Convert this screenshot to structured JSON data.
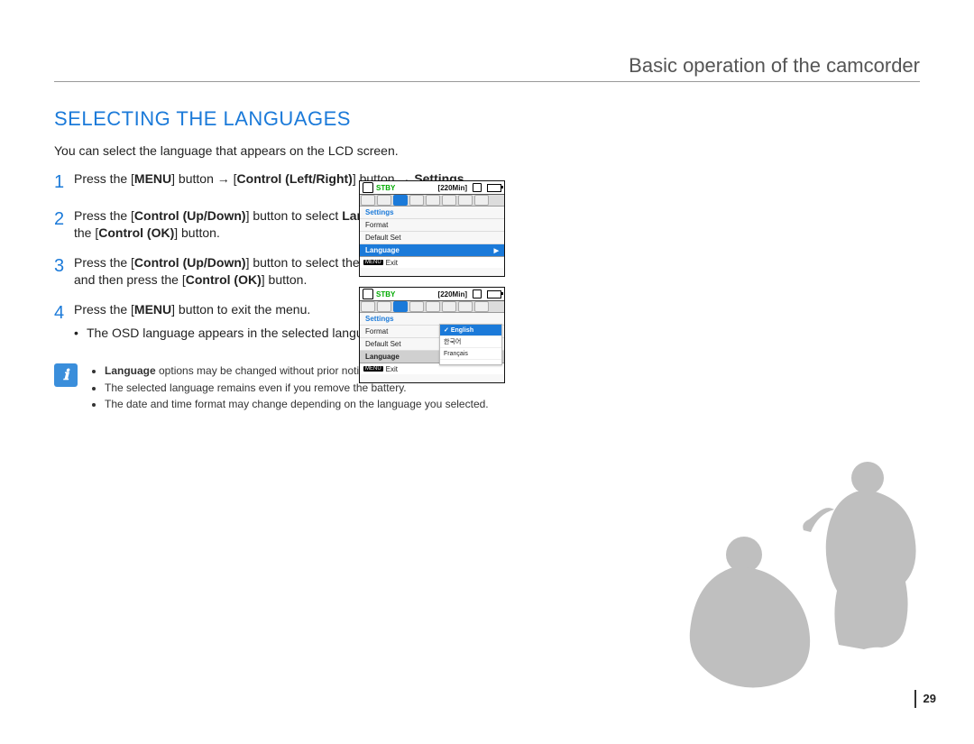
{
  "header": {
    "section": "Basic operation of the camcorder"
  },
  "title": "SELECTING THE LANGUAGES",
  "intro": "You can select the language that appears on the LCD screen.",
  "steps": [
    {
      "num": "1",
      "parts": [
        {
          "t": "Press the ["
        },
        {
          "t": "MENU",
          "b": true
        },
        {
          "t": "] button → ["
        },
        {
          "t": "Control (Left/Right)",
          "b": true
        },
        {
          "t": "] button → "
        },
        {
          "t": "Settings",
          "b": true
        },
        {
          "t": "."
        }
      ]
    },
    {
      "num": "2",
      "parts": [
        {
          "t": "Press the ["
        },
        {
          "t": "Control (Up/Down)",
          "b": true
        },
        {
          "t": "] button to select "
        },
        {
          "t": "Language",
          "b": true
        },
        {
          "t": ", and then press the ["
        },
        {
          "t": "Control (OK)",
          "b": true
        },
        {
          "t": "] button."
        }
      ]
    },
    {
      "num": "3",
      "parts": [
        {
          "t": "Press the ["
        },
        {
          "t": "Control (Up/Down)",
          "b": true
        },
        {
          "t": "] button to select the desired OSD language, and then press the ["
        },
        {
          "t": "Control (OK)",
          "b": true
        },
        {
          "t": "] button."
        }
      ]
    },
    {
      "num": "4",
      "parts": [
        {
          "t": "Press the ["
        },
        {
          "t": "MENU",
          "b": true
        },
        {
          "t": "] button to exit the menu."
        }
      ],
      "sub": "The OSD language appears in the selected language."
    }
  ],
  "lcd1": {
    "stby": "STBY",
    "time": "[220Min]",
    "settings": "Settings",
    "rows": [
      {
        "label": "Format",
        "sel": false
      },
      {
        "label": "Default Set",
        "sel": false
      },
      {
        "label": "Language",
        "sel": true
      }
    ],
    "menu": "MENU",
    "exit": "Exit"
  },
  "lcd2": {
    "stby": "STBY",
    "time": "[220Min]",
    "settings": "Settings",
    "rows": [
      {
        "label": "Format",
        "sel": false
      },
      {
        "label": "Default Set",
        "sel": false
      },
      {
        "label": "Language",
        "sel": true,
        "subtle": true
      }
    ],
    "popup": [
      {
        "label": "English",
        "sel": true
      },
      {
        "label": "한국어",
        "sel": false
      },
      {
        "label": "Français",
        "sel": false
      }
    ],
    "menu": "MENU",
    "exit": "Exit"
  },
  "notes": {
    "bullets": [
      {
        "pre": "Language",
        "rest": " options may be changed without prior notice."
      },
      {
        "pre": "",
        "rest": "The selected language remains even if you remove the battery."
      },
      {
        "pre": "",
        "rest": "The date and time format may change depending on the language you selected."
      }
    ]
  },
  "page_number": "29"
}
